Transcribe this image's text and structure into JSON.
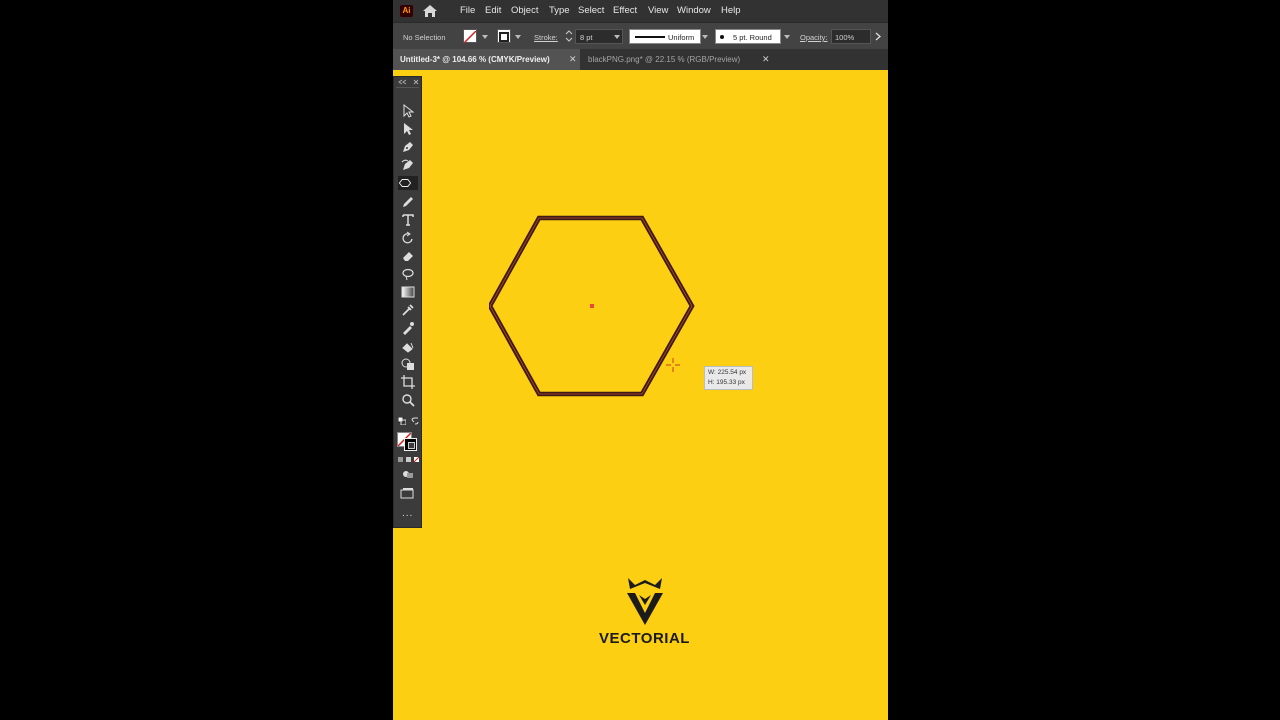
{
  "app": {
    "logo": "Ai"
  },
  "menu": [
    "File",
    "Edit",
    "Object",
    "Type",
    "Select",
    "Effect",
    "View",
    "Window",
    "Help"
  ],
  "control_bar": {
    "selection": "No Selection",
    "stroke_label": "Stroke:",
    "stroke_weight": "8 pt",
    "profile": "Uniform",
    "brush": "5 pt. Round",
    "opacity_label": "Opacity:",
    "opacity": "100%"
  },
  "tabs": [
    {
      "label": "Untitled-3* @ 104.66 % (CMYK/Preview)",
      "active": true
    },
    {
      "label": "blackPNG.png* @ 22.15 % (RGB/Preview)",
      "active": false
    }
  ],
  "tools": [
    "selection-tool-icon",
    "direct-selection-tool-icon",
    "pen-tool-icon",
    "curvature-tool-icon",
    "polygon-tool-icon",
    "pencil-tool-icon",
    "type-tool-icon",
    "rotate-tool-icon",
    "eraser-tool-icon",
    "lasso-tool-icon",
    "gradient-tool-icon",
    "eyedropper-tool-icon",
    "color-picker-icon",
    "paint-bucket-icon",
    "shape-builder-icon",
    "artboard-tool-icon",
    "zoom-tool-icon"
  ],
  "canvas": {
    "background": "#fccf12",
    "shape_stroke": "#3d1a14",
    "width_readout": "W: 225.54 px",
    "height_readout": "H: 195.33 px"
  },
  "brand": {
    "name": "VECTORIAL"
  },
  "more_label": "..."
}
